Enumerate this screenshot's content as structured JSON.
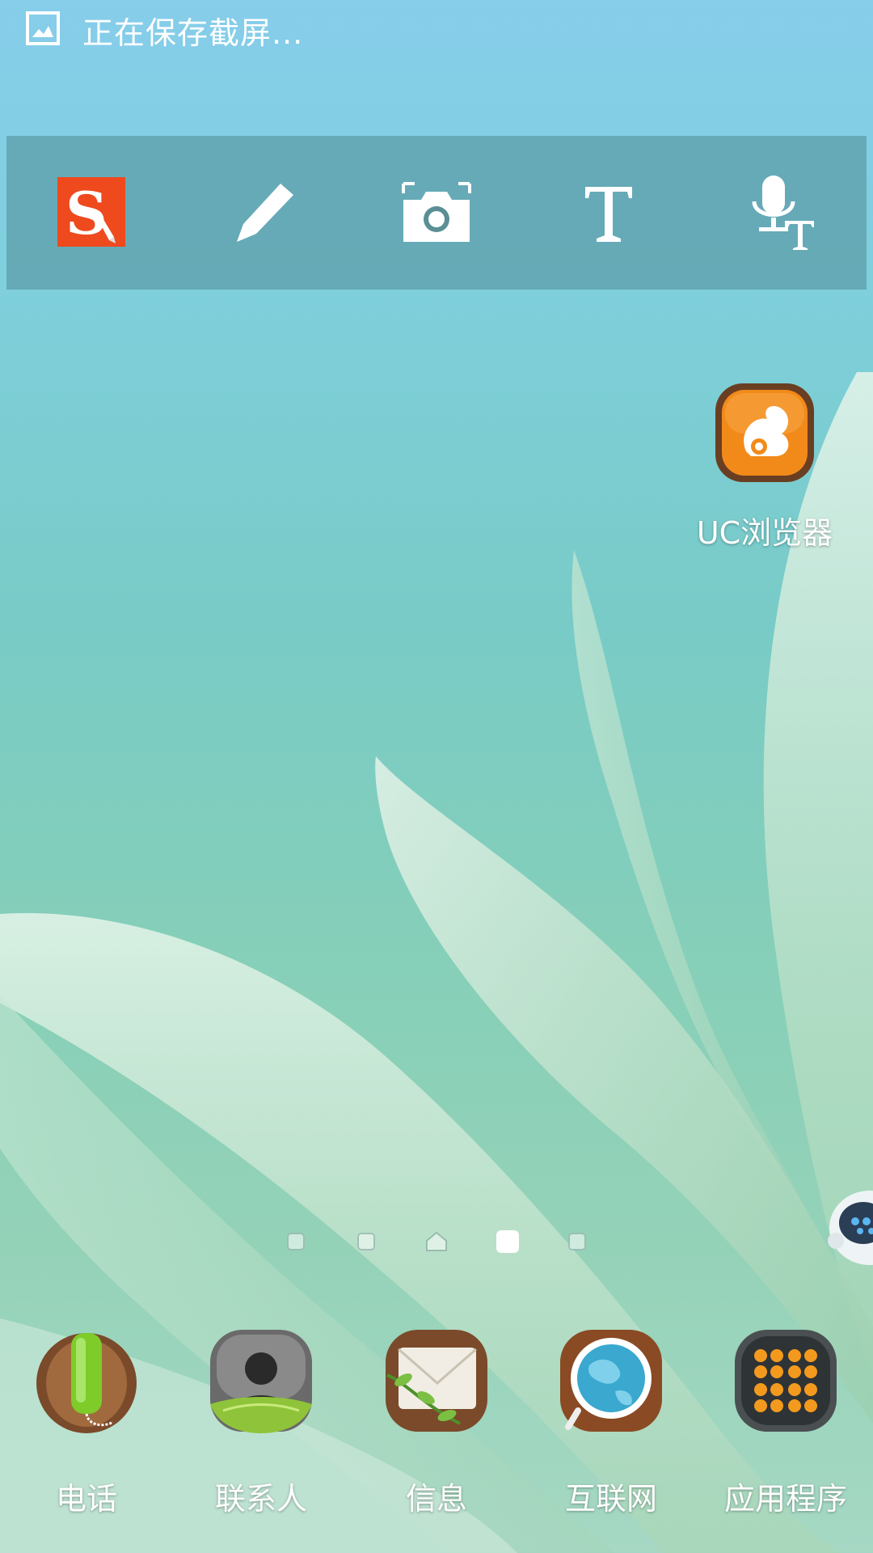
{
  "status": {
    "text": "正在保存截屏..."
  },
  "toolbar": {
    "tools": [
      "s-note-icon",
      "pen-icon",
      "screen-capture-icon",
      "text-icon",
      "voice-to-text-icon"
    ]
  },
  "desktop": {
    "uc_browser": {
      "label": "UC浏览器"
    }
  },
  "pager": {
    "pages": 5,
    "home_page": 3,
    "current_page": 4
  },
  "dock": {
    "items": [
      {
        "label": "电话",
        "icon": "phone-icon"
      },
      {
        "label": "联系人",
        "icon": "contacts-icon"
      },
      {
        "label": "信息",
        "icon": "messages-icon"
      },
      {
        "label": "互联网",
        "icon": "internet-icon"
      },
      {
        "label": "应用程序",
        "icon": "apps-icon"
      }
    ]
  },
  "colors": {
    "s_note_red": "#ee4a1e",
    "uc_orange": "#f28a1a",
    "wood": "#7a4a2a"
  }
}
